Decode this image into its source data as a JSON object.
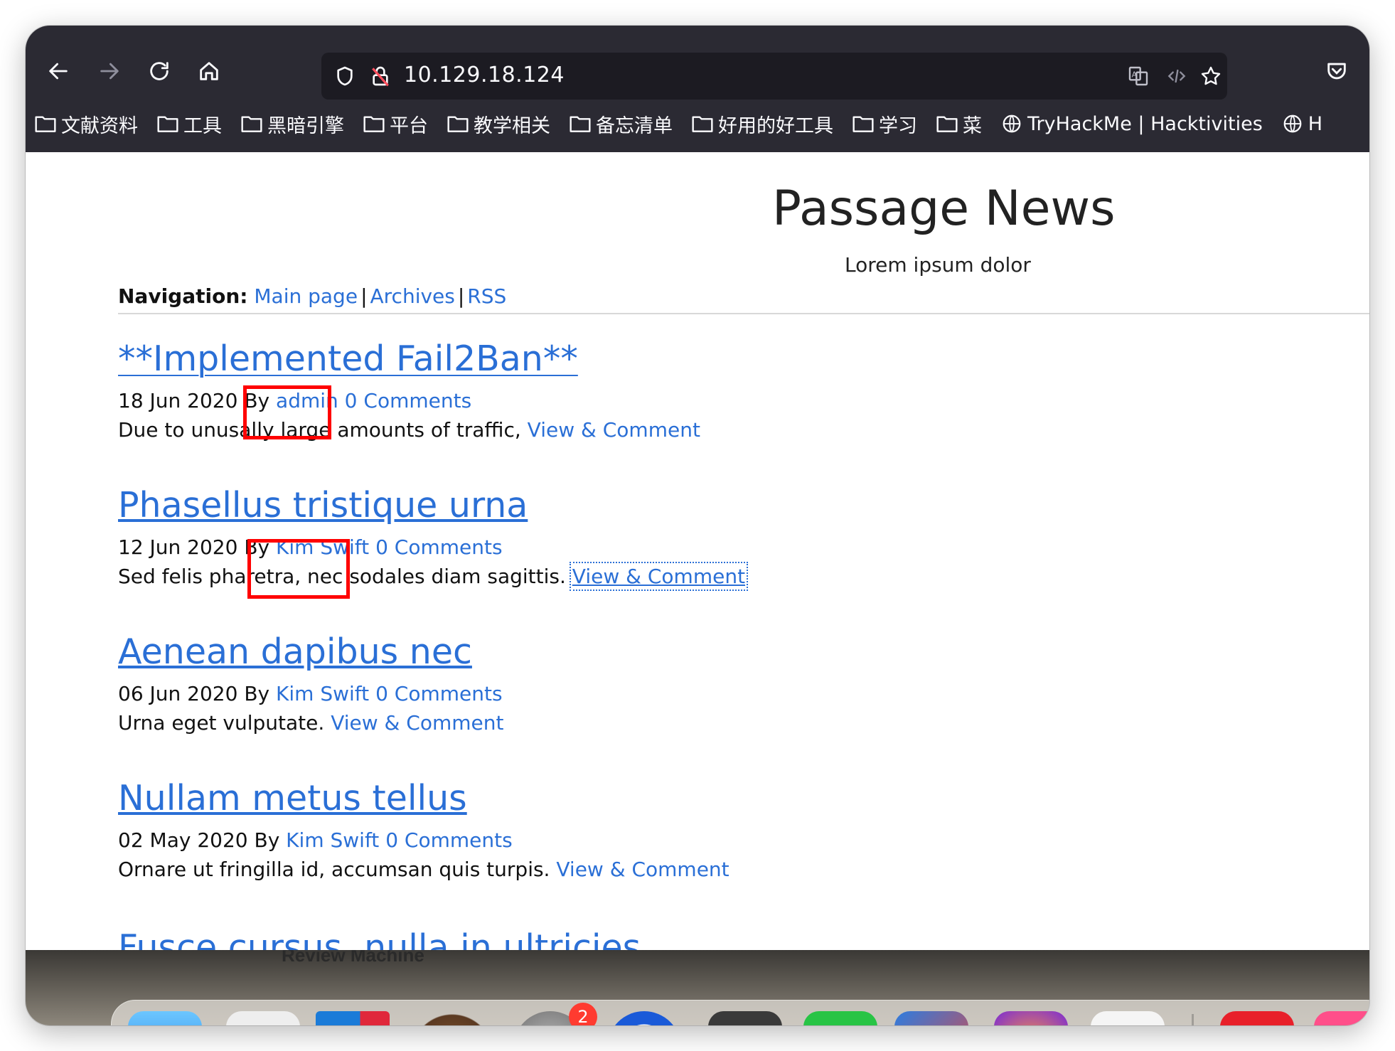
{
  "browser": {
    "url": "10.129.18.124",
    "bookmarks": [
      {
        "label": "文献资料",
        "icon": "folder-icon"
      },
      {
        "label": "工具",
        "icon": "folder-icon"
      },
      {
        "label": "黑暗引擎",
        "icon": "folder-icon"
      },
      {
        "label": "平台",
        "icon": "folder-icon"
      },
      {
        "label": "教学相关",
        "icon": "folder-icon"
      },
      {
        "label": "备忘清单",
        "icon": "folder-icon"
      },
      {
        "label": "好用的好工具",
        "icon": "folder-icon"
      },
      {
        "label": "学习",
        "icon": "folder-icon"
      },
      {
        "label": "菜",
        "icon": "folder-icon"
      },
      {
        "label": "TryHackMe | Hacktivities",
        "icon": "globe-icon"
      },
      {
        "label": "H",
        "icon": "globe-icon"
      }
    ]
  },
  "site": {
    "title": "Passage News",
    "subtitle": "Lorem ipsum dolor",
    "nav_label": "Navigation:",
    "nav_links": [
      "Main page",
      "Archives",
      "RSS"
    ],
    "nav_sep": "|"
  },
  "posts": [
    {
      "title": "**Implemented Fail2Ban**",
      "date": "18 Jun 2020",
      "by": "By",
      "author": "admin",
      "comments": "0 Comments",
      "excerpt": "Due to unusally large amounts of traffic,",
      "link": "View & Comment"
    },
    {
      "title": "Phasellus tristique urna",
      "date": "12 Jun 2020",
      "by": "By",
      "author": "Kim Swift",
      "comments": "0 Comments",
      "excerpt": "Sed felis pharetra, nec sodales diam sagittis.",
      "link": "View & Comment"
    },
    {
      "title": "Aenean dapibus nec",
      "date": "06 Jun 2020",
      "by": "By",
      "author": "Kim Swift",
      "comments": "0 Comments",
      "excerpt": "Urna eget vulputate.",
      "link": "View & Comment"
    },
    {
      "title": "Nullam metus tellus",
      "date": "02 May 2020",
      "by": "By",
      "author": "Kim Swift",
      "comments": "0 Comments",
      "excerpt": "Ornare ut fringilla id, accumsan quis turpis.",
      "link": "View & Comment"
    }
  ],
  "partial_post_title": "Fusce cursus, nulla in ultricies",
  "desktop": {
    "label": "Review Machine",
    "badge_count": "2"
  },
  "colors": {
    "link": "#2a6fd6",
    "toolbar": "#2b2a33",
    "annotation": "#ff0000"
  }
}
